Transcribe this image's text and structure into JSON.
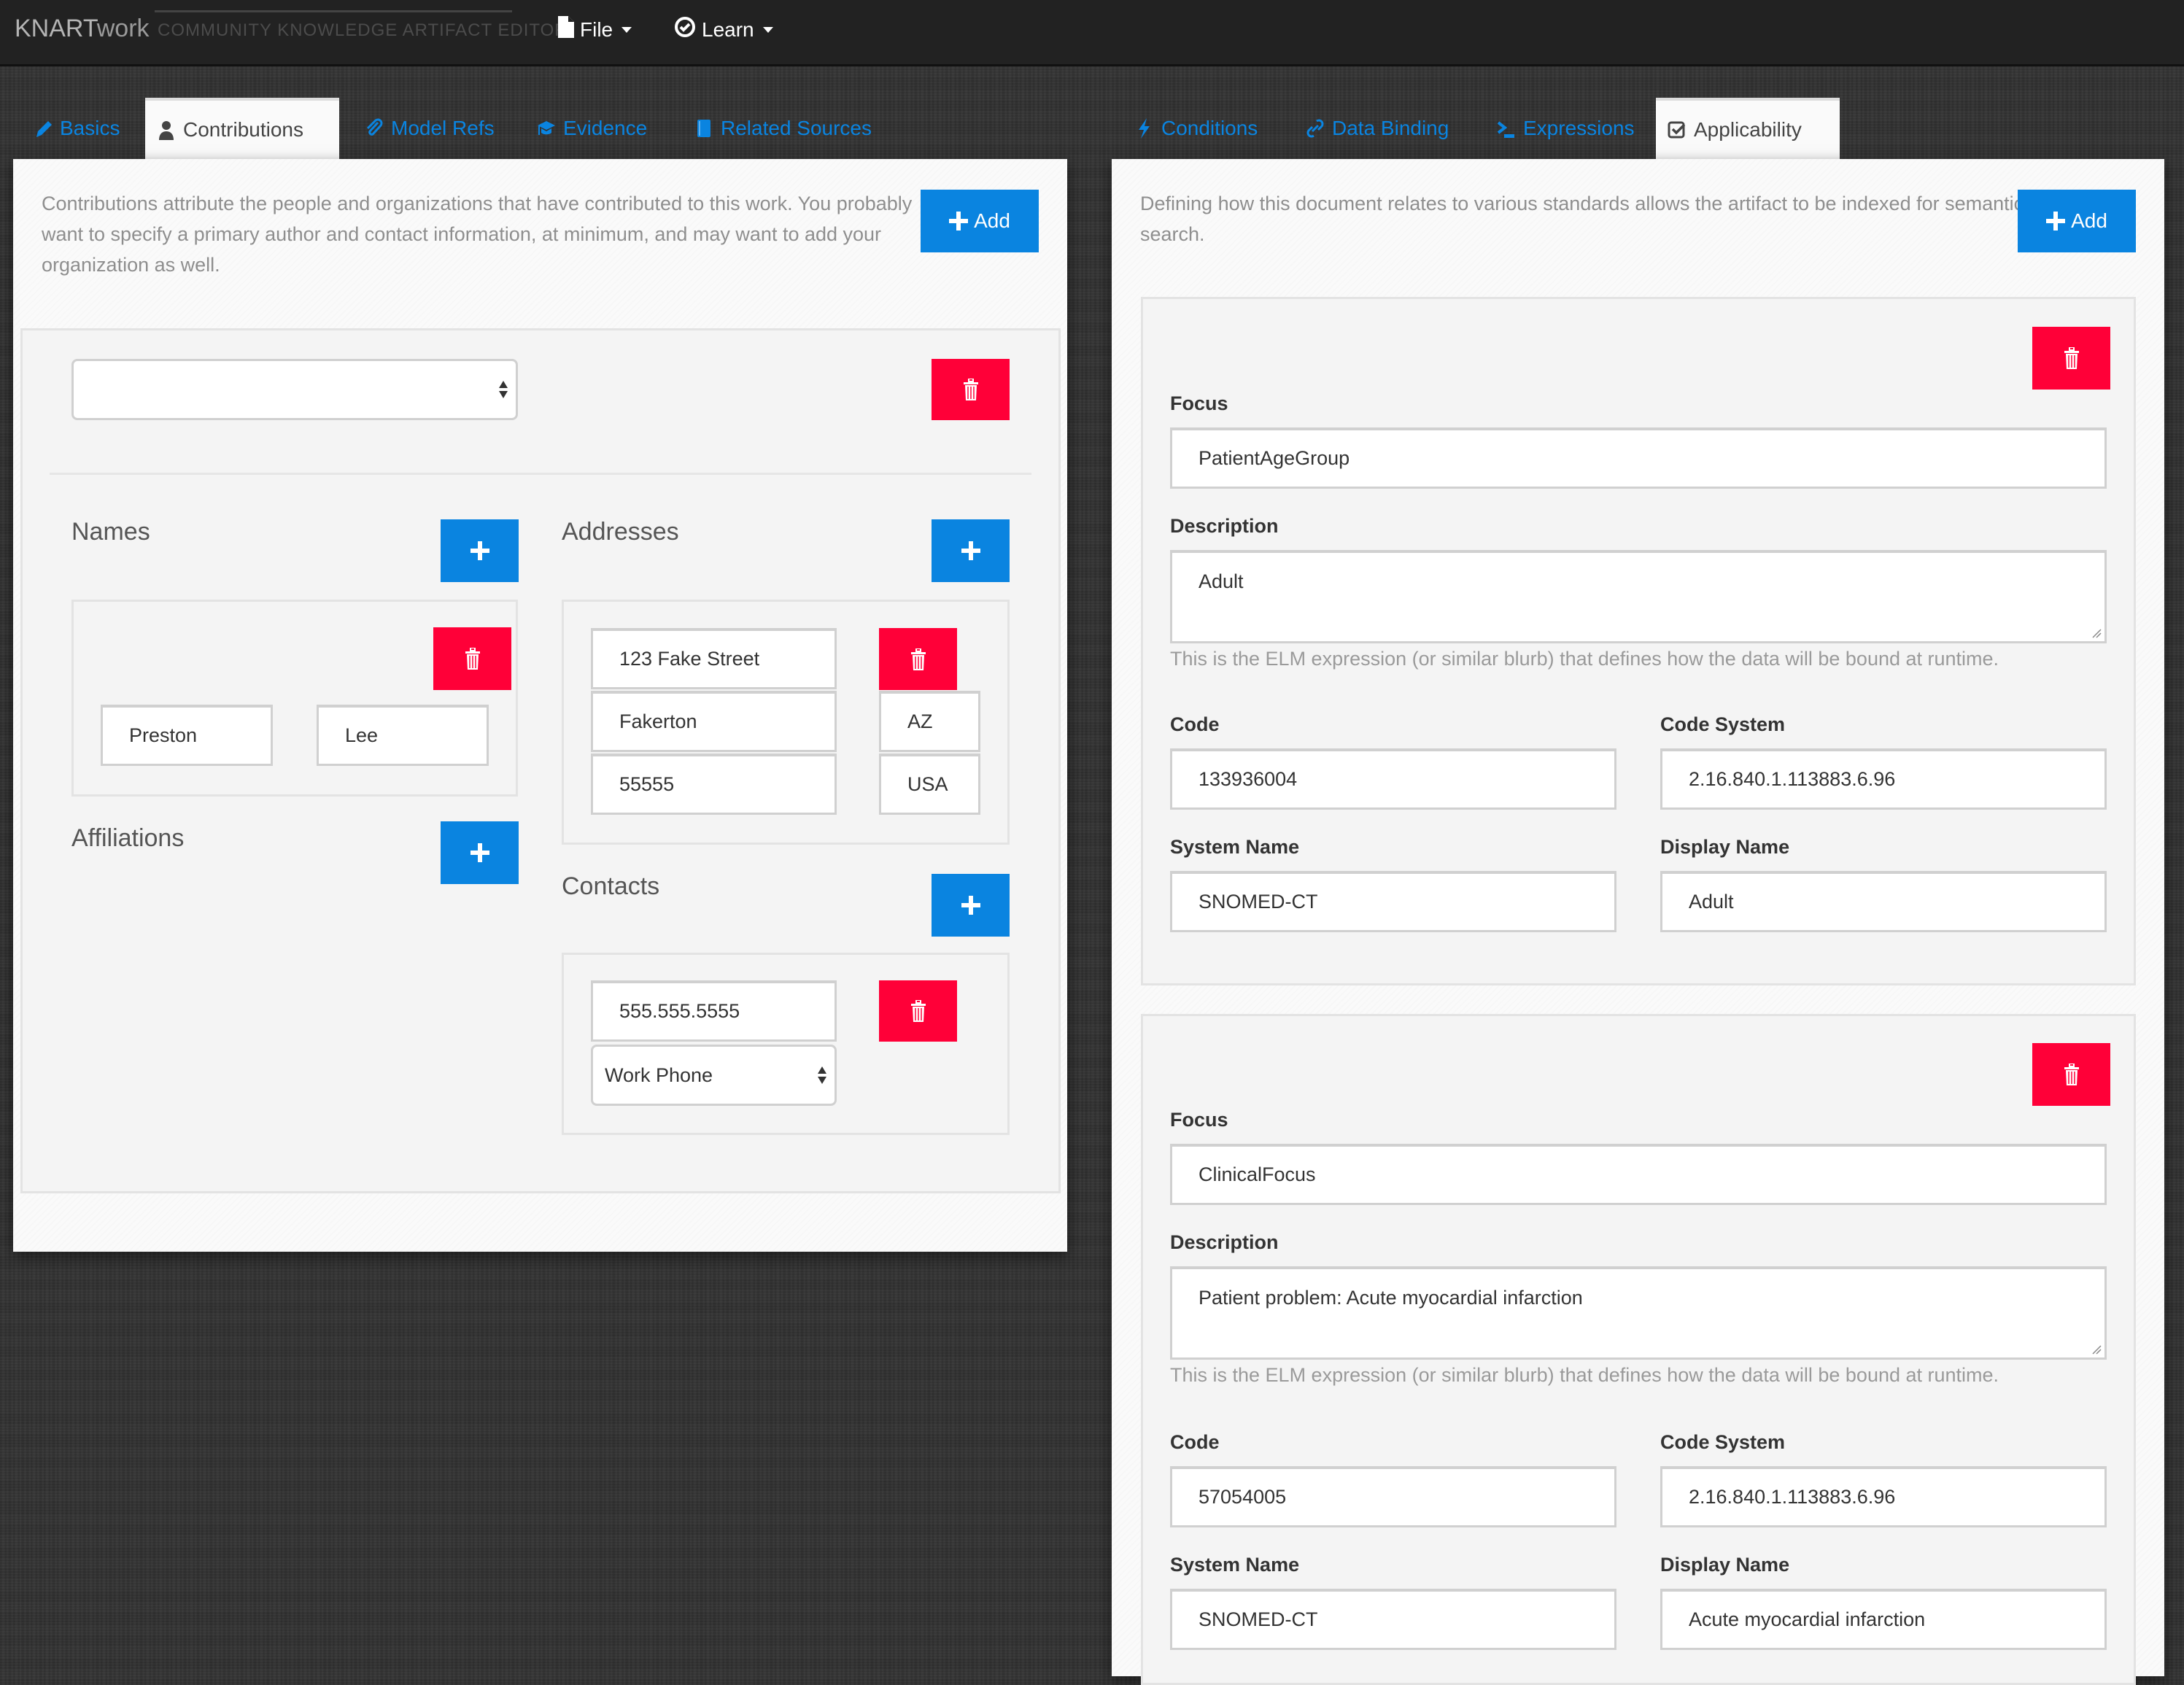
{
  "app": {
    "brand_strong": "KNART",
    "brand_light": "work",
    "tagline": "COMMUNITY KNOWLEDGE ARTIFACT EDITOR",
    "menus": [
      {
        "label": "File",
        "icon": "file-icon"
      },
      {
        "label": "Learn",
        "icon": "check-circle-icon"
      }
    ]
  },
  "left": {
    "tabs": [
      {
        "label": "Basics",
        "icon": "pencil-icon",
        "active": false
      },
      {
        "label": "Contributions",
        "icon": "user-icon",
        "active": true
      },
      {
        "label": "Model Refs",
        "icon": "paperclip-icon",
        "active": false
      },
      {
        "label": "Evidence",
        "icon": "graduation-cap-icon",
        "active": false
      },
      {
        "label": "Related Sources",
        "icon": "book-icon",
        "active": false
      }
    ],
    "intro": "Contributions attribute the people and organizations that have contributed to this work. You probably want to specify a primary author and contact information, at minimum, and may want to add your organization as well.",
    "add_label": "Add",
    "contribution": {
      "type_select_value": "",
      "names_title": "Names",
      "names": [
        {
          "first": "Preston",
          "last": "Lee"
        }
      ],
      "affiliations_title": "Affiliations",
      "addresses_title": "Addresses",
      "address": {
        "street": "123 Fake Street",
        "city": "Fakerton",
        "state": "AZ",
        "postal": "55555",
        "country": "USA"
      },
      "contacts_title": "Contacts",
      "contact": {
        "value": "555.555.5555",
        "type": "Work Phone"
      }
    }
  },
  "right": {
    "tabs": [
      {
        "label": "Conditions",
        "icon": "bolt-icon",
        "active": false
      },
      {
        "label": "Data Binding",
        "icon": "link-icon",
        "active": false
      },
      {
        "label": "Expressions",
        "icon": "terminal-icon",
        "active": false
      },
      {
        "label": "Applicability",
        "icon": "checkbox-icon",
        "active": true
      }
    ],
    "intro": "Defining how this document relates to various standards allows the artifact to be indexed for semantic search.",
    "add_label": "Add",
    "labels": {
      "focus": "Focus",
      "description": "Description",
      "help": "This is the ELM expression (or similar blurb) that defines how the data will be bound at runtime.",
      "code": "Code",
      "code_system": "Code System",
      "system_name": "System Name",
      "display_name": "Display Name"
    },
    "entries": [
      {
        "focus": "PatientAgeGroup",
        "description": "Adult",
        "code": "133936004",
        "code_system": "2.16.840.1.113883.6.96",
        "system_name": "SNOMED-CT",
        "display_name": "Adult"
      },
      {
        "focus": "ClinicalFocus",
        "description": "Patient problem: Acute myocardial infarction",
        "code": "57054005",
        "code_system": "2.16.840.1.113883.6.96",
        "system_name": "SNOMED-CT",
        "display_name": "Acute myocardial infarction"
      }
    ]
  },
  "colors": {
    "accent": "#0a84e0",
    "danger": "#ff0038",
    "header_bg": "#222222"
  }
}
